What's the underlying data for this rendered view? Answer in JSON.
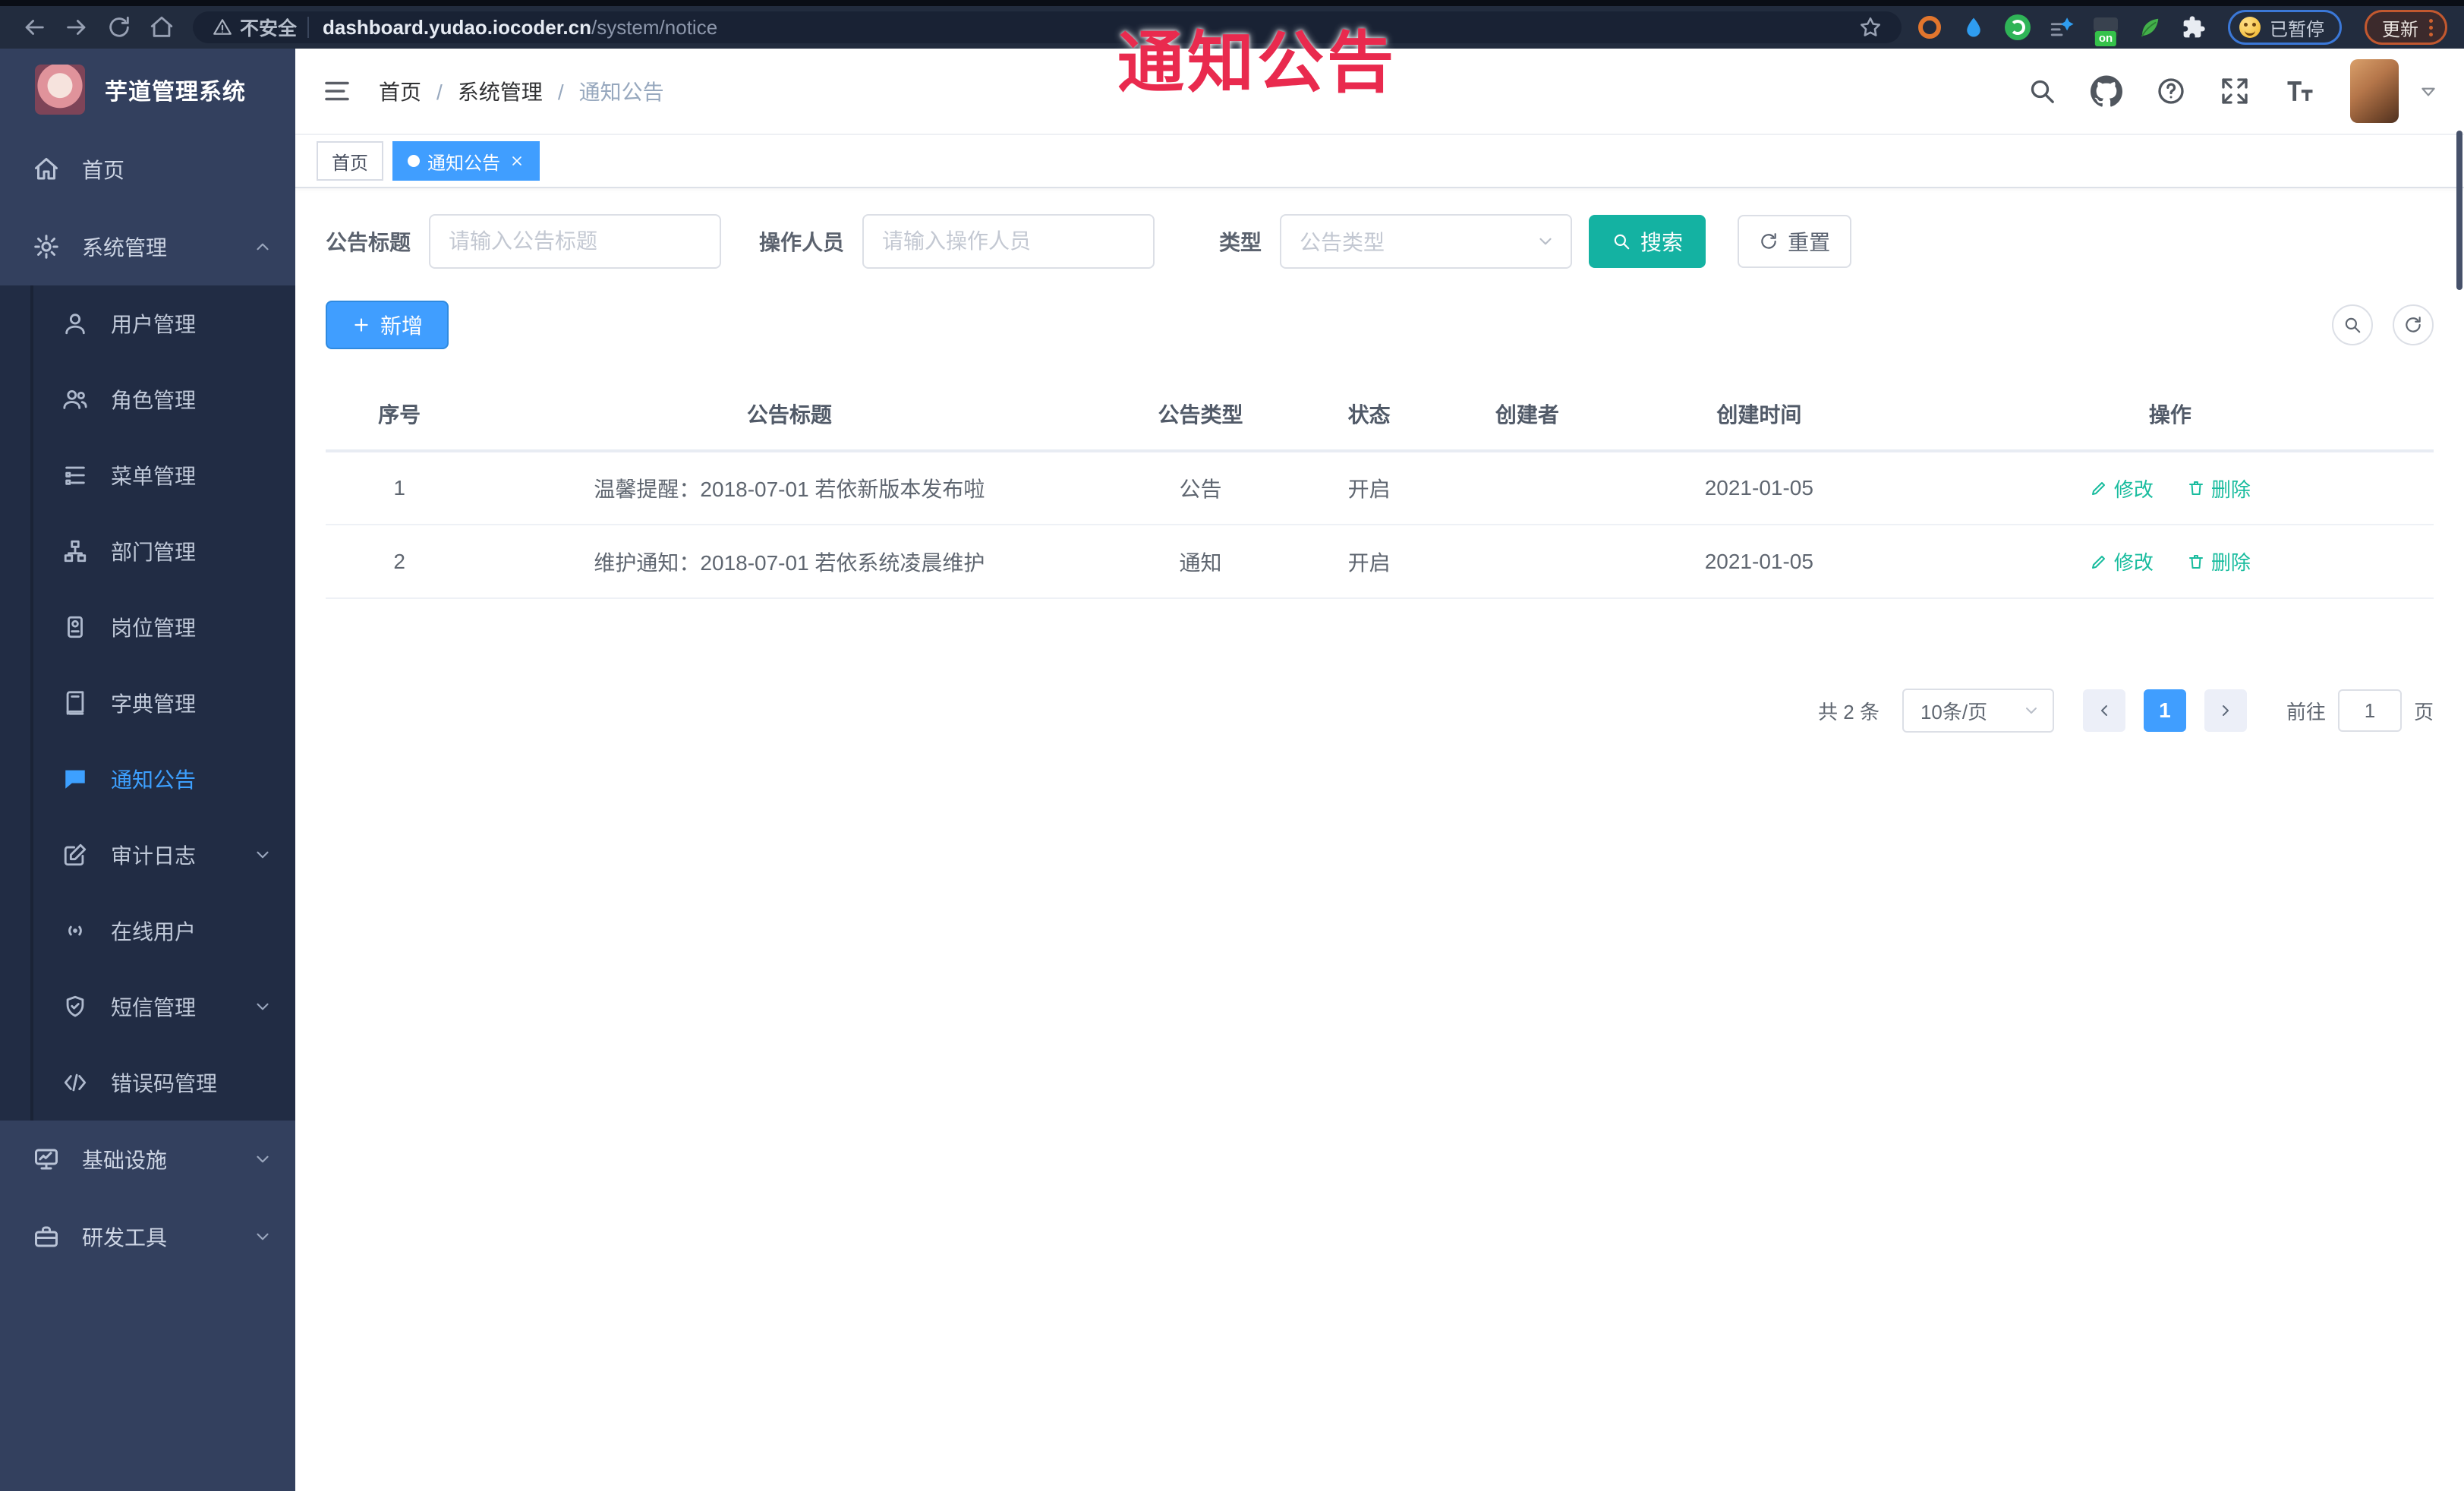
{
  "browser": {
    "insecure_label": "不安全",
    "url_host": "dashboard.yudao.iocoder.cn",
    "url_path": "/system/notice",
    "ext_badge": "on",
    "paused_label": "已暂停",
    "update_label": "更新"
  },
  "overlay": {
    "text": "通知公告"
  },
  "colors": {
    "accent_blue": "#409eff",
    "search_teal": "#14b2a2",
    "link_teal": "#19bc9e",
    "overlay_red": "#e92a4e",
    "sidebar_bg": "#33405e",
    "submenu_bg": "#212c44"
  },
  "sidebar": {
    "title": "芋道管理系统",
    "items": [
      {
        "label": "首页"
      },
      {
        "label": "系统管理"
      },
      {
        "label": "用户管理"
      },
      {
        "label": "角色管理"
      },
      {
        "label": "菜单管理"
      },
      {
        "label": "部门管理"
      },
      {
        "label": "岗位管理"
      },
      {
        "label": "字典管理"
      },
      {
        "label": "通知公告"
      },
      {
        "label": "审计日志"
      },
      {
        "label": "在线用户"
      },
      {
        "label": "短信管理"
      },
      {
        "label": "错误码管理"
      },
      {
        "label": "基础设施"
      },
      {
        "label": "研发工具"
      }
    ]
  },
  "header": {
    "breadcrumbs": [
      "首页",
      "系统管理",
      "通知公告"
    ]
  },
  "tabs": [
    {
      "label": "首页"
    },
    {
      "label": "通知公告"
    }
  ],
  "filters": {
    "title_label": "公告标题",
    "title_placeholder": "请输入公告标题",
    "operator_label": "操作人员",
    "operator_placeholder": "请输入操作人员",
    "type_label": "类型",
    "type_placeholder": "公告类型",
    "search_label": "搜索",
    "reset_label": "重置"
  },
  "toolbar": {
    "add_label": "新增"
  },
  "table": {
    "columns": [
      "序号",
      "公告标题",
      "公告类型",
      "状态",
      "创建者",
      "创建时间",
      "操作"
    ],
    "rows": [
      {
        "no": "1",
        "title": "温馨提醒：2018-07-01 若依新版本发布啦",
        "type": "公告",
        "status": "开启",
        "creator": "",
        "created": "2021-01-05"
      },
      {
        "no": "2",
        "title": "维护通知：2018-07-01 若依系统凌晨维护",
        "type": "通知",
        "status": "开启",
        "creator": "",
        "created": "2021-01-05"
      }
    ],
    "edit_label": "修改",
    "delete_label": "删除"
  },
  "pagination": {
    "total": "共 2 条",
    "page_size": "10条/页",
    "current": "1",
    "goto_label": "前往",
    "goto_value": "1",
    "page_unit": "页"
  }
}
